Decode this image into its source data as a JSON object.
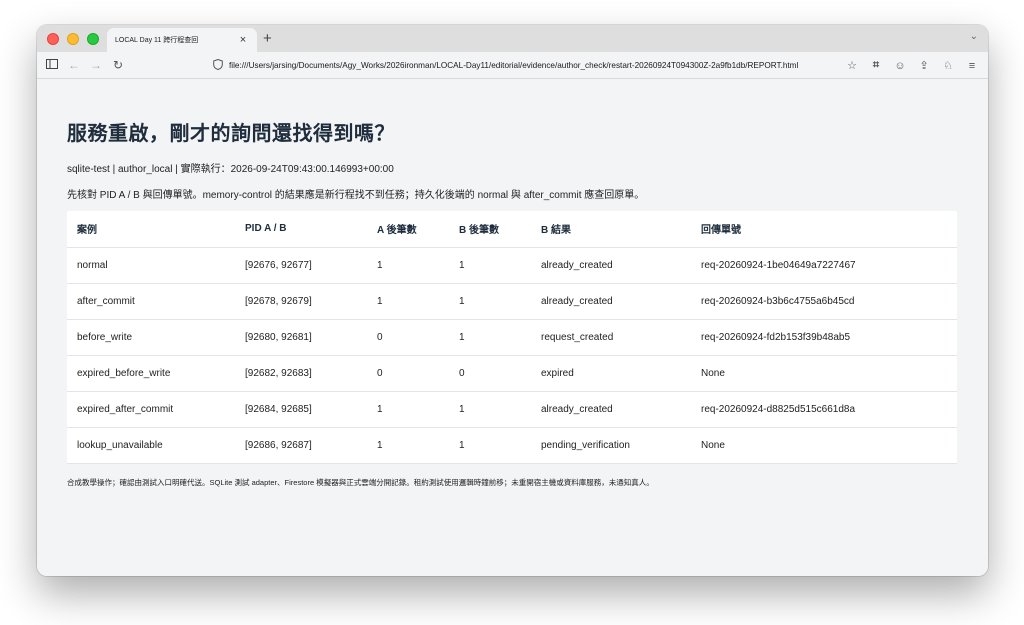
{
  "browser": {
    "tab_title": "LOCAL Day 11 跨行程查回",
    "tab_close": "×",
    "new_tab": "+",
    "url": "file:///Users/jarsing/Documents/Agy_Works/2026ironman/LOCAL-Day11/editorial/evidence/author_check/restart-20260924T094300Z-2a9fb1db/REPORT.html"
  },
  "page": {
    "title": "服務重啟，剛才的詢問還找得到嗎？",
    "meta": "sqlite-test | author_local | 實際執行：2026-09-24T09:43:00.146993+00:00",
    "note": "先核對 PID A / B 與回傳單號。memory-control 的結果應是新行程找不到任務；持久化後端的 normal 與 after_commit 應查回原單。",
    "footer": "合成教學操作；確認由測試入口明確代送。SQLite 測試 adapter、Firestore 模擬器與正式雲端分開記錄。租約測試使用邏輯時鐘前移；未重開宿主機或資料庫服務，未通知真人。"
  },
  "table": {
    "headers": [
      "案例",
      "PID A / B",
      "A 後筆數",
      "B 後筆數",
      "B 結果",
      "回傳單號"
    ],
    "rows": [
      [
        "normal",
        "[92676, 92677]",
        "1",
        "1",
        "already_created",
        "req-20260924-1be04649a7227467"
      ],
      [
        "after_commit",
        "[92678, 92679]",
        "1",
        "1",
        "already_created",
        "req-20260924-b3b6c4755a6b45cd"
      ],
      [
        "before_write",
        "[92680, 92681]",
        "0",
        "1",
        "request_created",
        "req-20260924-fd2b153f39b48ab5"
      ],
      [
        "expired_before_write",
        "[92682, 92683]",
        "0",
        "0",
        "expired",
        "None"
      ],
      [
        "expired_after_commit",
        "[92684, 92685]",
        "1",
        "1",
        "already_created",
        "req-20260924-d8825d515c661d8a"
      ],
      [
        "lookup_unavailable",
        "[92686, 92687]",
        "1",
        "1",
        "pending_verification",
        "None"
      ]
    ]
  }
}
